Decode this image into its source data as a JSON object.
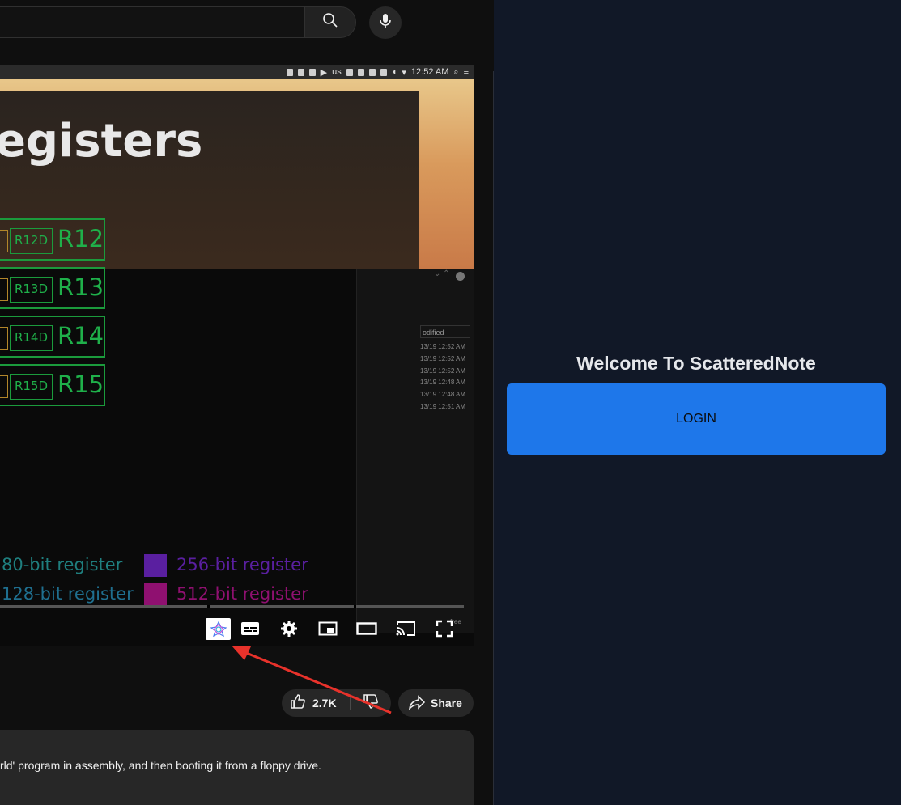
{
  "youtube": {
    "search": {
      "placeholder": ""
    },
    "player": {
      "system_clock": "12:52 AM",
      "system_locale": "us",
      "slide_title": "egisters",
      "registers": [
        {
          "small": "R12D",
          "big": "R12"
        },
        {
          "small": "R13D",
          "big": "R13"
        },
        {
          "small": "R14D",
          "big": "R14"
        },
        {
          "small": "R15D",
          "big": "R15"
        }
      ],
      "legend": [
        {
          "label": "80-bit register",
          "color": "#1f7f7f"
        },
        {
          "label": "128-bit register",
          "color": "#1f6f8f"
        },
        {
          "label": "256-bit register",
          "color": "#5a1fa0"
        },
        {
          "label": "512-bit register",
          "color": "#8f1070"
        }
      ],
      "file_manager": {
        "column_header": "odified",
        "rows": [
          "13/19 12:52 AM",
          "13/19 12:52 AM",
          "13/19 12:52 AM",
          "13/19 12:48 AM",
          "13/19 12:48 AM",
          "13/19 12:51 AM"
        ],
        "footer": "free"
      },
      "controls": [
        "extension-icon",
        "subtitles-icon",
        "settings-icon",
        "miniplayer-icon",
        "theater-icon",
        "cast-icon",
        "fullscreen-icon"
      ]
    },
    "actions": {
      "like_count": "2.7K",
      "share_label": "Share"
    },
    "description": "rld' program in assembly, and then booting it from a floppy drive."
  },
  "panel": {
    "welcome": "Welcome To ScatteredNote",
    "login_label": "LOGIN"
  },
  "colors": {
    "panel_bg": "#111827",
    "login_button": "#1e77ea",
    "register_green": "#1fb04a",
    "arrow": "#e8322b"
  }
}
